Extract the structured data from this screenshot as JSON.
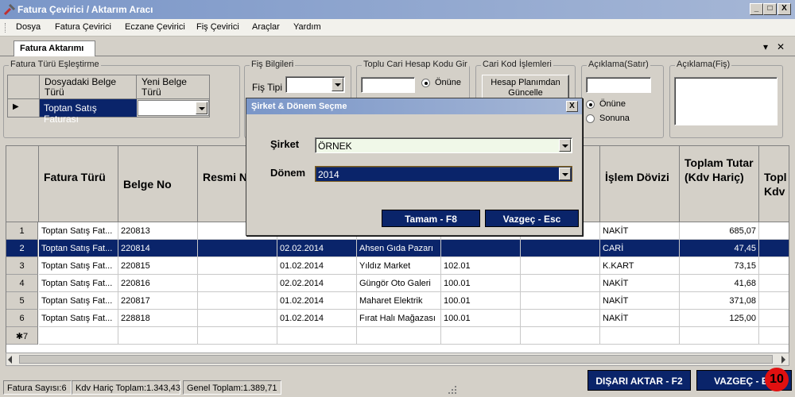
{
  "window": {
    "title": "Fatura Çevirici / Aktarım Aracı",
    "min": "_",
    "max": "□",
    "close": "X"
  },
  "menu": [
    "Dosya",
    "Fatura Çevirici",
    "Eczane Çevirici",
    "Fiş Çevirici",
    "Araçlar",
    "Yardım"
  ],
  "tab": {
    "label": "Fatura Aktarımı",
    "pin": "▾",
    "close": "✕"
  },
  "mapping": {
    "caption": "Fatura Türü Eşleştirme",
    "col1": "Dosyadaki Belge Türü",
    "col2": "Yeni Belge Türü",
    "row_value": "Toptan Satış Faturası",
    "row_marker": "▶"
  },
  "fis_bilgileri": {
    "caption": "Fiş Bilgileri",
    "label": "Fiş Tipi"
  },
  "toplu_cari": {
    "caption": "Toplu Cari Hesap Kodu Gir",
    "radio1": "Önüne"
  },
  "cari_kod": {
    "caption": "Cari Kod İşlemleri",
    "button": "Hesap Planımdan Güncelle"
  },
  "aciklama_satir": {
    "caption": "Açıklama(Satır)",
    "radio1": "Önüne",
    "radio2": "Sonuna"
  },
  "aciklama_fis": {
    "caption": "Açıklama(Fiş)"
  },
  "grid": {
    "headers": [
      "Fatura Türü",
      "Belge No",
      "Resmi No",
      "",
      "",
      "",
      "",
      "İşlem Dövizi",
      "Toplam Tutar (Kdv Hariç)",
      "Topl Kdv"
    ],
    "rows": [
      {
        "num": "1",
        "tur": "Toptan Satış Fat...",
        "belge": "220813",
        "resmi": "",
        "tarih": "",
        "cari": "",
        "kod": "",
        "doviz": "NAKİT",
        "tutar": "685,07"
      },
      {
        "num": "2",
        "tur": "Toptan Satış Fat...",
        "belge": "220814",
        "resmi": "",
        "tarih": "02.02.2014",
        "cari": "Ahsen Gıda Pazarı",
        "kod": "",
        "doviz": "CARİ",
        "tutar": "47,45"
      },
      {
        "num": "3",
        "tur": "Toptan Satış Fat...",
        "belge": "220815",
        "resmi": "",
        "tarih": "01.02.2014",
        "cari": "Yıldız Market",
        "kod": "102.01",
        "doviz": "K.KART",
        "tutar": "73,15"
      },
      {
        "num": "4",
        "tur": "Toptan Satış Fat...",
        "belge": "220816",
        "resmi": "",
        "tarih": "02.02.2014",
        "cari": "Güngör Oto Galeri",
        "kod": "100.01",
        "doviz": "NAKİT",
        "tutar": "41,68"
      },
      {
        "num": "5",
        "tur": "Toptan Satış Fat...",
        "belge": "220817",
        "resmi": "",
        "tarih": "01.02.2014",
        "cari": "Maharet Elektrik",
        "kod": "100.01",
        "doviz": "NAKİT",
        "tutar": "371,08"
      },
      {
        "num": "6",
        "tur": "Toptan Satış Fat...",
        "belge": "228818",
        "resmi": "",
        "tarih": "01.02.2014",
        "cari": "Fırat Halı Mağazası",
        "kod": "100.01",
        "doviz": "NAKİT",
        "tutar": "125,00"
      }
    ],
    "new_row_marker": "✱7"
  },
  "dialog": {
    "title": "Şirket & Dönem Seçme",
    "sirket_label": "Şirket",
    "sirket_value": "ÖRNEK",
    "donem_label": "Dönem",
    "donem_value": "2014",
    "ok": "Tamam - F8",
    "cancel": "Vazgeç - Esc",
    "close": "X"
  },
  "status": {
    "count": "Fatura Sayısı:6",
    "kdv": "Kdv Hariç Toplam:1.343,43",
    "genel": "Genel Toplam:1.389,71"
  },
  "buttons": {
    "export": "DIŞARI AKTAR - F2",
    "cancel": "VAZGEÇ - ES"
  },
  "badge": "10"
}
